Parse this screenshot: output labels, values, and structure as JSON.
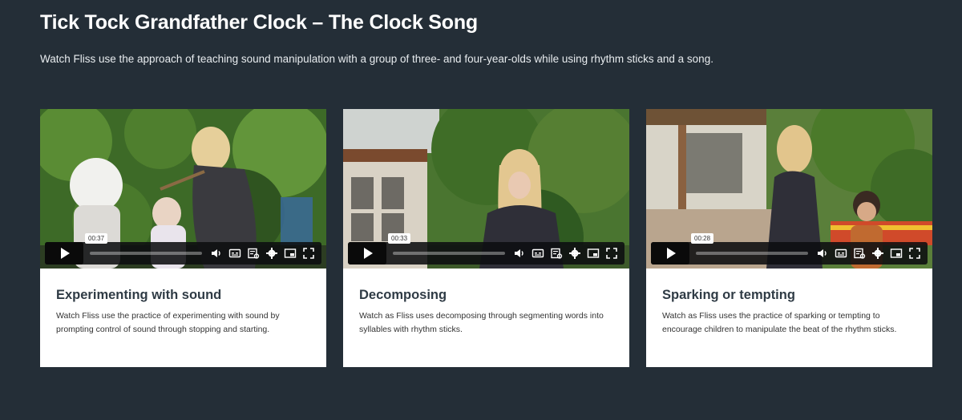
{
  "page": {
    "title": "Tick Tock Grandfather Clock – The Clock Song",
    "intro": "Watch Fliss use the approach of teaching sound manipulation with a group of three- and four-year-olds while using rhythm sticks and a song."
  },
  "cards": [
    {
      "title": "Experimenting with sound",
      "description": "Watch Fliss use the practice of experimenting with sound by prompting control of sound through stopping and starting.",
      "duration": "00:37"
    },
    {
      "title": "Decomposing",
      "description": "Watch as Fliss uses decomposing through segmenting words into syllables with rhythm sticks.",
      "duration": "00:33"
    },
    {
      "title": "Sparking or tempting",
      "description": "Watch as Fliss uses the practice of sparking or tempting to encourage children to manipulate the beat of the rhythm sticks.",
      "duration": "00:28"
    }
  ],
  "player": {
    "icons": [
      "play-icon",
      "volume-icon",
      "captions-icon",
      "transcript-icon",
      "settings-icon",
      "picture-in-picture-icon",
      "fullscreen-icon"
    ]
  },
  "colors": {
    "background": "#242e37",
    "card": "#ffffff",
    "title_text": "#2f3b45"
  }
}
